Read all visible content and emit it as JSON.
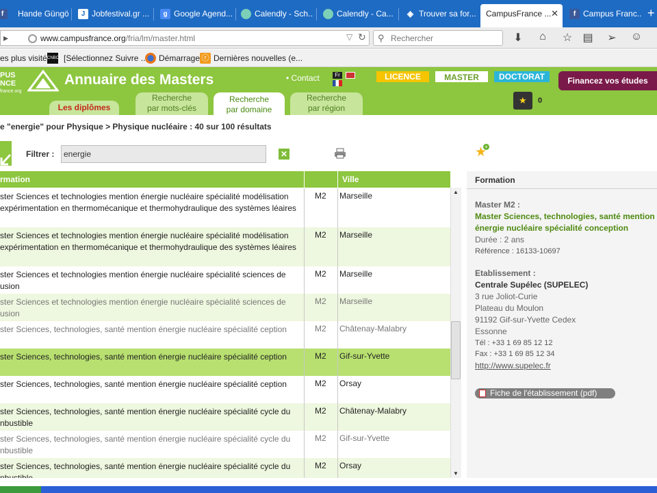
{
  "browser": {
    "tabs": [
      {
        "label": "Hande Güngör",
        "icon": "facebook-icon"
      },
      {
        "label": "Jobfestival.gr ...",
        "icon": "jobfestival-icon"
      },
      {
        "label": "Google Agend...",
        "icon": "google-icon"
      },
      {
        "label": "Calendly - Sch...",
        "icon": "calendly-icon"
      },
      {
        "label": "Calendly - Ca...",
        "icon": "calendly-icon"
      },
      {
        "label": "Trouver sa for...",
        "icon": "campusfrance-icon"
      },
      {
        "label": "CampusFrance ...",
        "icon": "campusfrance-icon",
        "active": true
      },
      {
        "label": "Campus Franc...",
        "icon": "facebook-icon"
      }
    ],
    "new_tab": "+",
    "url_domain": "www.campusfrance.org",
    "url_path": "/fria/lm/master.html",
    "search_placeholder": "Rechercher",
    "bookmarks": [
      {
        "label": "es plus visités"
      },
      {
        "label": "[Sélectionnez Suivre ..."
      },
      {
        "label": "Démarrage"
      },
      {
        "label": "Dernières nouvelles (e..."
      }
    ]
  },
  "site": {
    "logo_text_1": "PUS",
    "logo_text_2": "NCE",
    "logo_text_3": "france.org",
    "title": "Annuaire des Masters",
    "contact": "• Contact",
    "flag_fr": "Fr",
    "levels": [
      "LICENCE",
      "MASTER",
      "DOCTORAT"
    ],
    "finance": "Financez vos études",
    "nav_tabs": [
      {
        "label": "Les diplômes"
      },
      {
        "label_1": "Recherche",
        "label_2": "par mots-clés"
      },
      {
        "label_1": "Recherche",
        "label_2": "par domaine"
      },
      {
        "label_1": "Recherche",
        "label_2": "par région"
      }
    ],
    "basket_count": "0"
  },
  "results": {
    "breadcrumb": "e \"energie\" pour Physique > Physique nucléaire : 40 sur 100 résultats",
    "filter_label": "Filtrer :",
    "filter_value": "energie",
    "columns": [
      "rmation",
      "",
      "Ville"
    ],
    "rows": [
      {
        "formation": "ster Sciences et technologies mention énergie nucléaire spécialité modélisation expérimentation en thermomécanique et thermohydraulique des systèmes léaires",
        "niveau": "M2",
        "ville": "Marseille"
      },
      {
        "formation": "ster Sciences et technologies mention énergie nucléaire spécialité modélisation expérimentation en thermomécanique et thermohydraulique des systèmes léaires",
        "niveau": "M2",
        "ville": "Marseille"
      },
      {
        "formation": "ster Sciences et technologies mention énergie nucléaire spécialité sciences de usion",
        "niveau": "M2",
        "ville": "Marseille"
      },
      {
        "formation": "ster Sciences et technologies mention énergie nucléaire spécialité sciences de usion",
        "niveau": "M2",
        "ville": "Marseille"
      },
      {
        "formation": "ster Sciences, technologies, santé mention énergie nucléaire spécialité ception",
        "niveau": "M2",
        "ville": "Châtenay-Malabry"
      },
      {
        "formation": "ster Sciences, technologies, santé mention énergie nucléaire spécialité ception",
        "niveau": "M2",
        "ville": "Gif-sur-Yvette"
      },
      {
        "formation": "ster Sciences, technologies, santé mention énergie nucléaire spécialité ception",
        "niveau": "M2",
        "ville": "Orsay"
      },
      {
        "formation": "ster Sciences, technologies, santé mention énergie nucléaire spécialité cycle du nbustible",
        "niveau": "M2",
        "ville": "Châtenay-Malabry"
      },
      {
        "formation": "ster Sciences, technologies, santé mention énergie nucléaire spécialité cycle du nbustible",
        "niveau": "M2",
        "ville": "Gif-sur-Yvette"
      },
      {
        "formation": "ster Sciences, technologies, santé mention énergie nucléaire spécialité cycle du nbustible",
        "niveau": "M2",
        "ville": "Orsay"
      }
    ]
  },
  "detail": {
    "title": "Formation",
    "level_label": "Master M2 :",
    "name_1": "Master Sciences, technologies, santé mention",
    "name_2": "énergie nucléaire spécialité conception",
    "duree": "Durée : 2 ans",
    "reference": "Référence : 16133-10697",
    "etab_label": "Etablissement :",
    "etab_name": "Centrale Supélec (SUPELEC)",
    "address_1": "3 rue Joliot-Curie",
    "address_2": "Plateau du Moulon",
    "address_3": "91192 Gif-sur-Yvette Cedex",
    "address_4": "Essonne",
    "tel": "Tél : +33 1 69 85 12 12",
    "fax": "Fax : +33 1 69 85 12 34",
    "website": "http://www.supelec.fr",
    "pdf_button": "Fiche de l'établissement (pdf)"
  }
}
